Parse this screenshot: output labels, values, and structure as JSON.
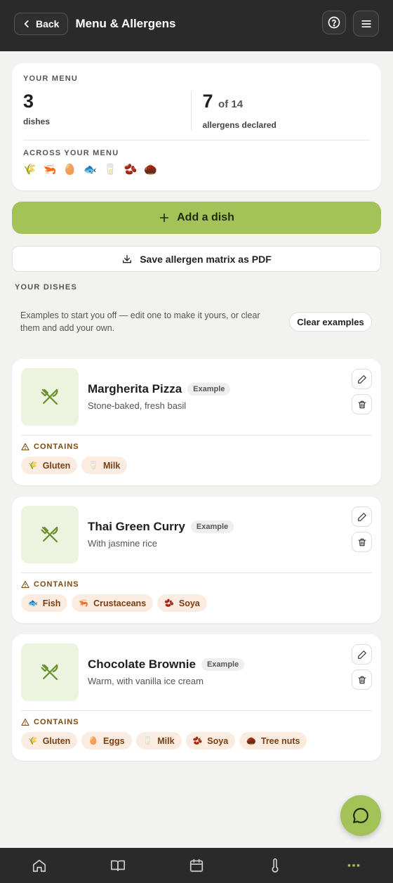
{
  "header": {
    "back_label": "Back",
    "title": "Menu & Allergens"
  },
  "summary": {
    "kicker": "YOUR MENU",
    "dishes_count": "3",
    "dishes_label": "dishes",
    "allergens_count": "7",
    "allergens_total": "of 14",
    "allergens_label": "allergens declared",
    "across_kicker": "ACROSS YOUR MENU",
    "allergen_icons": [
      "🌾",
      "🦐",
      "🥚",
      "🐟",
      "🥛",
      "🫘",
      "🌰"
    ]
  },
  "actions": {
    "add_dish": "Add a dish",
    "save_pdf": "Save allergen matrix as PDF"
  },
  "dishes_section": {
    "title": "YOUR DISHES",
    "note": "Examples to start you off — edit one to make it yours, or clear them and add your own.",
    "clear_label": "Clear examples"
  },
  "dishes": [
    {
      "name": "Margherita Pizza",
      "badge": "Example",
      "desc": "Stone-baked, fresh basil",
      "contains_label": "CONTAINS",
      "allergens": [
        {
          "icon": "🌾",
          "label": "Gluten"
        },
        {
          "icon": "🥛",
          "label": "Milk"
        }
      ]
    },
    {
      "name": "Thai Green Curry",
      "badge": "Example",
      "desc": "With jasmine rice",
      "contains_label": "CONTAINS",
      "allergens": [
        {
          "icon": "🐟",
          "label": "Fish"
        },
        {
          "icon": "🦐",
          "label": "Crustaceans"
        },
        {
          "icon": "🫘",
          "label": "Soya"
        }
      ]
    },
    {
      "name": "Chocolate Brownie",
      "badge": "Example",
      "desc": "Warm, with vanilla ice cream",
      "contains_label": "CONTAINS",
      "allergens": [
        {
          "icon": "🌾",
          "label": "Gluten"
        },
        {
          "icon": "🥚",
          "label": "Eggs"
        },
        {
          "icon": "🥛",
          "label": "Milk"
        },
        {
          "icon": "🫘",
          "label": "Soya"
        },
        {
          "icon": "🌰",
          "label": "Tree nuts"
        }
      ]
    }
  ],
  "colors": {
    "accent": "#a3c257",
    "header_bg": "#2a2a2a",
    "chip_bg": "#fbece1",
    "chip_text": "#7a3f12"
  }
}
